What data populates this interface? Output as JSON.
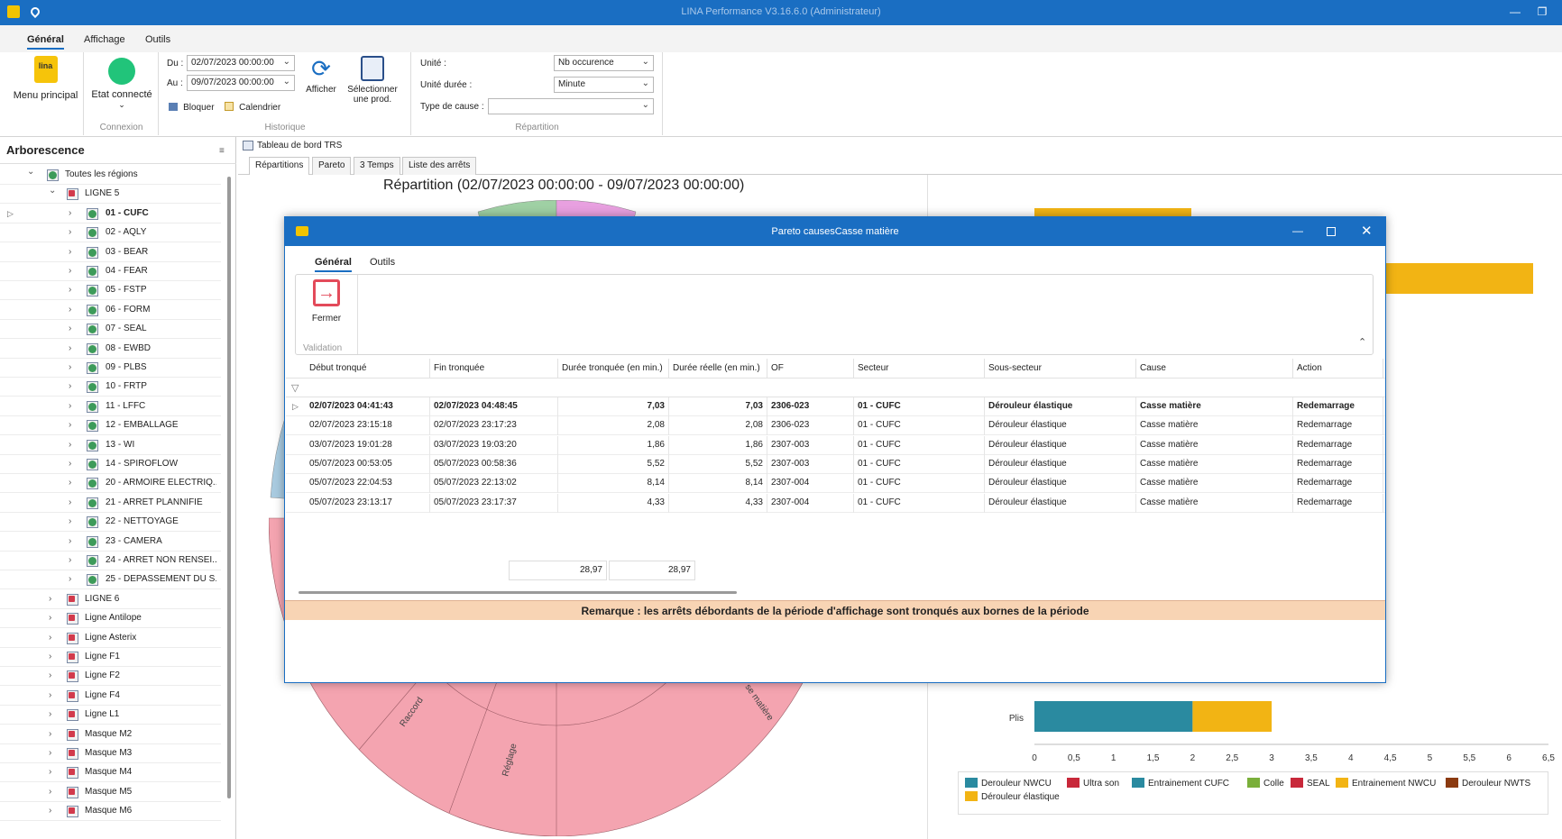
{
  "window": {
    "title": "LINA Performance  V3.16.6.0  (Administrateur)"
  },
  "menu": {
    "tabs": [
      "Général",
      "Affichage",
      "Outils"
    ]
  },
  "ribbon": {
    "menu_principal": "Menu principal",
    "logo_text": "lina",
    "etat_connecte": "Etat connecté",
    "connexion_group": "Connexion",
    "du_label": "Du :",
    "du_value": "02/07/2023 00:00:00",
    "au_label": "Au :",
    "au_value": "09/07/2023 00:00:00",
    "bloquer": "Bloquer",
    "calendrier": "Calendrier",
    "afficher": "Afficher",
    "selectionner": "Sélectionner une prod.",
    "historique_group": "Historique",
    "unite_label": "Unité :",
    "unite_value": "Nb occurence",
    "unite_duree_label": "Unité durée :",
    "unite_duree_value": "Minute",
    "type_cause_label": "Type de cause :",
    "type_cause_value": "",
    "repartition_group": "Répartition"
  },
  "tree": {
    "title": "Arborescence",
    "root": "Toutes les régions",
    "ligne5": "LIGNE 5",
    "children": [
      "01 - CUFC",
      "02 - AQLY",
      "03 - BEAR",
      "04 - FEAR",
      "05 - FSTP",
      "06 - FORM",
      "07 - SEAL",
      "08 - EWBD",
      "09 - PLBS",
      "10 - FRTP",
      "11 - LFFC",
      "12 - EMBALLAGE",
      "13 - WI",
      "14 - SPIROFLOW",
      "20 - ARMOIRE ELECTRIQ...",
      "21 - ARRET PLANNIFIE",
      "22 - NETTOYAGE",
      "23 - CAMERA",
      "24 - ARRET NON RENSEI...",
      "25 - DEPASSEMENT DU S..."
    ],
    "lines": [
      "LIGNE 6",
      "Ligne Antilope",
      "Ligne Asterix",
      "Ligne F1",
      "Ligne F2",
      "Ligne F4",
      "Ligne L1",
      "Masque M2",
      "Masque M3",
      "Masque M4",
      "Masque M5",
      "Masque M6"
    ]
  },
  "dashboard": {
    "header": "Tableau de bord TRS",
    "tabs": [
      "Répartitions",
      "Pareto",
      "3 Temps",
      "Liste des arrêts"
    ],
    "title": "Répartition (02/07/2023 00:00:00 - 09/07/2023 00:00:00)",
    "pie_labels": [
      "Raccord",
      "Réglage",
      "se matière"
    ]
  },
  "dialog": {
    "title": "Pareto causesCasse matière",
    "tabs": [
      "Général",
      "Outils"
    ],
    "fermer": "Fermer",
    "validation_group": "Validation",
    "columns": [
      "Début tronqué",
      "Fin tronquée",
      "Durée tronquée (en min.)",
      "Durée réelle (en min.)",
      "OF",
      "Secteur",
      "Sous-secteur",
      "Cause",
      "Action"
    ],
    "rows": [
      [
        "02/07/2023 04:41:43",
        "02/07/2023 04:48:45",
        "7,03",
        "7,03",
        "2306-023",
        "01 - CUFC",
        "Dérouleur élastique",
        "Casse matière",
        "Redemarrage"
      ],
      [
        "02/07/2023 23:15:18",
        "02/07/2023 23:17:23",
        "2,08",
        "2,08",
        "2306-023",
        "01 - CUFC",
        "Dérouleur élastique",
        "Casse matière",
        "Redemarrage"
      ],
      [
        "03/07/2023 19:01:28",
        "03/07/2023 19:03:20",
        "1,86",
        "1,86",
        "2307-003",
        "01 - CUFC",
        "Dérouleur élastique",
        "Casse matière",
        "Redemarrage"
      ],
      [
        "05/07/2023 00:53:05",
        "05/07/2023 00:58:36",
        "5,52",
        "5,52",
        "2307-003",
        "01 - CUFC",
        "Dérouleur élastique",
        "Casse matière",
        "Redemarrage"
      ],
      [
        "05/07/2023 22:04:53",
        "05/07/2023 22:13:02",
        "8,14",
        "8,14",
        "2307-004",
        "01 - CUFC",
        "Dérouleur élastique",
        "Casse matière",
        "Redemarrage"
      ],
      [
        "05/07/2023 23:13:17",
        "05/07/2023 23:17:37",
        "4,33",
        "4,33",
        "2307-004",
        "01 - CUFC",
        "Dérouleur élastique",
        "Casse matière",
        "Redemarrage"
      ]
    ],
    "total_tronquee": "28,97",
    "total_reelle": "28,97",
    "remark": "Remarque : les arrêts débordants de la période d'affichage sont tronqués aux bornes de la période"
  },
  "chart_data": {
    "type": "bar",
    "orientation": "horizontal",
    "categories": [
      "Plis"
    ],
    "series": [
      {
        "name": "Derouleur NWCU",
        "values": [
          2
        ]
      },
      {
        "name": "Ultra son",
        "values": [
          0
        ]
      },
      {
        "name": "Entrainement  CUFC",
        "values": [
          0
        ]
      },
      {
        "name": "Colle",
        "values": [
          0
        ]
      },
      {
        "name": "SEAL",
        "values": [
          0
        ]
      },
      {
        "name": "Entrainement  NWCU",
        "values": [
          1
        ]
      },
      {
        "name": "Derouleur NWTS",
        "values": [
          0
        ]
      },
      {
        "name": "Dérouleur élastique",
        "values": [
          0
        ]
      }
    ],
    "colors": [
      "#2a8aa0",
      "#c8283a",
      "#2a8aa0",
      "#7aaf3a",
      "#c8283a",
      "#f2b414",
      "#8b3a10",
      "#f2b414"
    ],
    "xlim": [
      0,
      6.5
    ],
    "xticks": [
      "0",
      "0,5",
      "1",
      "1,5",
      "2",
      "2,5",
      "3",
      "3,5",
      "4",
      "4,5",
      "5",
      "5,5",
      "6",
      "6,5"
    ],
    "legend_position": "bottom"
  }
}
